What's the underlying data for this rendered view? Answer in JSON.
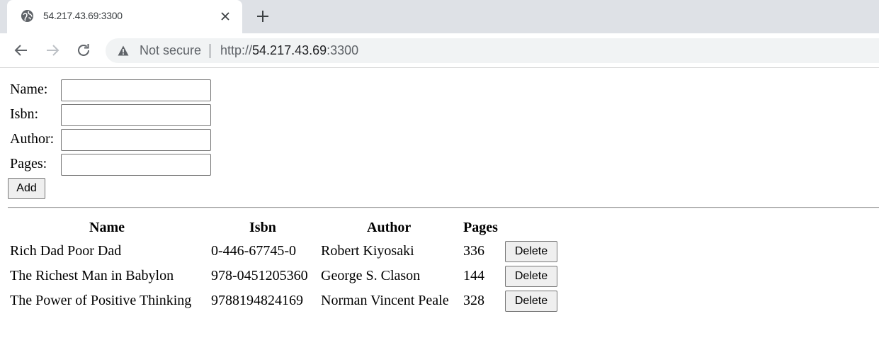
{
  "browser": {
    "tab_title": "54.217.43.69:3300",
    "security_label": "Not secure",
    "url_scheme": "http://",
    "url_host": "54.217.43.69",
    "url_port": ":3300"
  },
  "form": {
    "name_label": "Name:",
    "isbn_label": "Isbn:",
    "author_label": "Author:",
    "pages_label": "Pages:",
    "name_value": "",
    "isbn_value": "",
    "author_value": "",
    "pages_value": "",
    "add_label": "Add"
  },
  "table": {
    "headers": [
      "Name",
      "Isbn",
      "Author",
      "Pages"
    ],
    "rows": [
      {
        "name": "Rich Dad Poor Dad",
        "isbn": "0-446-67745-0",
        "author": "Robert Kiyosaki",
        "pages": "336",
        "action": "Delete"
      },
      {
        "name": "The Richest Man in Babylon",
        "isbn": "978-0451205360",
        "author": "George S. Clason",
        "pages": "144",
        "action": "Delete"
      },
      {
        "name": "The Power of Positive Thinking",
        "isbn": "9788194824169",
        "author": "Norman Vincent Peale",
        "pages": "328",
        "action": "Delete"
      }
    ]
  }
}
